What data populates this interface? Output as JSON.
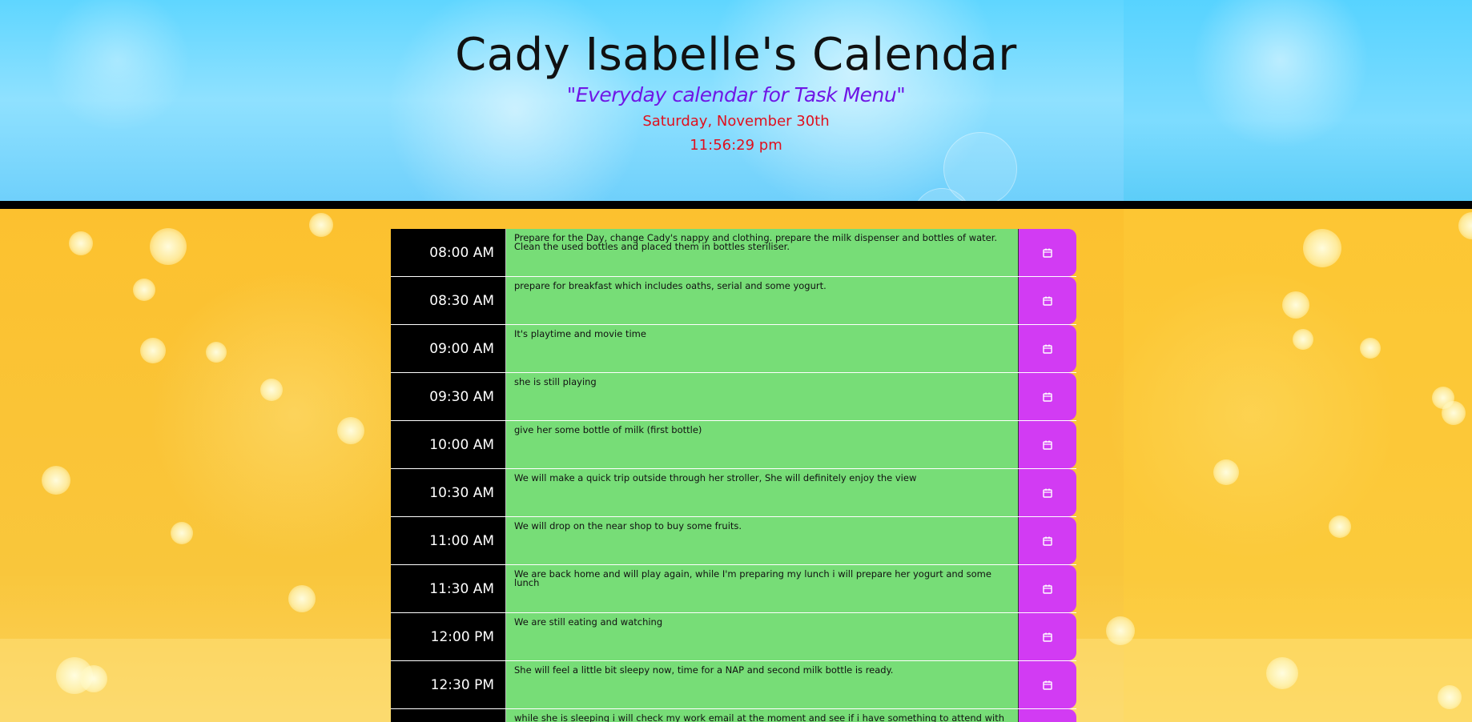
{
  "header": {
    "title": "Cady Isabelle's Calendar",
    "subtitle": "\"Everyday calendar for Task Menu\"",
    "date": "Saturday, November 30th",
    "time": "11:56:29 pm"
  },
  "colors": {
    "header_bg": "#6fd6ff",
    "body_bg": "#fcc12f",
    "hour_bg": "#000000",
    "task_bg": "#77dd77",
    "save_bg": "#d23bf3",
    "subtitle_color": "#6f17e6",
    "date_color": "#e0101e"
  },
  "schedule": {
    "save_icon": "calendar-save-icon",
    "rows": [
      {
        "hour": "08:00 AM",
        "task": "Prepare for the Day, change Cady's nappy and clothing. prepare the milk dispenser and bottles of water. Clean the used bottles and placed them in bottles steriliser."
      },
      {
        "hour": "08:30 AM",
        "task": "prepare for breakfast which includes oaths, serial and some yogurt."
      },
      {
        "hour": "09:00 AM",
        "task": "It's playtime and movie time"
      },
      {
        "hour": "09:30 AM",
        "task": "she is still playing"
      },
      {
        "hour": "10:00 AM",
        "task": "give her some bottle of milk (first bottle)"
      },
      {
        "hour": "10:30 AM",
        "task": "We will make a quick trip outside through her stroller, She will definitely enjoy the view"
      },
      {
        "hour": "11:00 AM",
        "task": "We will drop on the near shop to buy some fruits."
      },
      {
        "hour": "11:30 AM",
        "task": "We are back home and will play again, while I'm preparing my lunch i will prepare her yogurt and some lunch"
      },
      {
        "hour": "12:00 PM",
        "task": "We are still eating and watching"
      },
      {
        "hour": "12:30 PM",
        "task": "She will feel a little bit sleepy now, time for a NAP and second milk bottle is ready."
      },
      {
        "hour": "",
        "task": "while she is sleeping i will check my work email at the moment and see if i have something to attend with"
      }
    ]
  }
}
